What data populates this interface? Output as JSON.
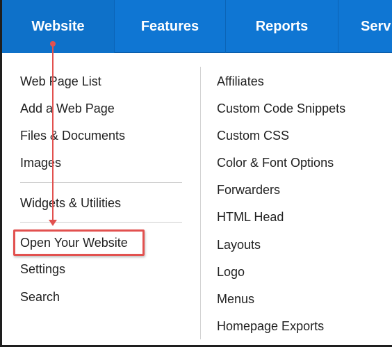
{
  "nav": {
    "tabs": [
      {
        "label": "Website",
        "active": true
      },
      {
        "label": "Features",
        "active": false
      },
      {
        "label": "Reports",
        "active": false
      },
      {
        "label": "Serv",
        "active": false
      }
    ],
    "bar_color": "#0f76d3"
  },
  "menu": {
    "left": [
      {
        "label": "Web Page List"
      },
      {
        "label": "Add a Web Page"
      },
      {
        "label": "Files & Documents"
      },
      {
        "label": "Images"
      },
      {
        "label": "Widgets & Utilities"
      },
      {
        "label": "Open Your Website",
        "highlighted": true
      },
      {
        "label": "Settings"
      },
      {
        "label": "Search"
      }
    ],
    "right": [
      {
        "label": "Affiliates"
      },
      {
        "label": "Custom Code Snippets"
      },
      {
        "label": "Custom CSS"
      },
      {
        "label": "Color & Font Options"
      },
      {
        "label": "Forwarders"
      },
      {
        "label": "HTML Head"
      },
      {
        "label": "Layouts"
      },
      {
        "label": "Logo"
      },
      {
        "label": "Menus"
      },
      {
        "label": "Homepage Exports"
      }
    ]
  },
  "annotation": {
    "color": "#e2514f",
    "arrow_icon": "down-arrow-icon"
  }
}
